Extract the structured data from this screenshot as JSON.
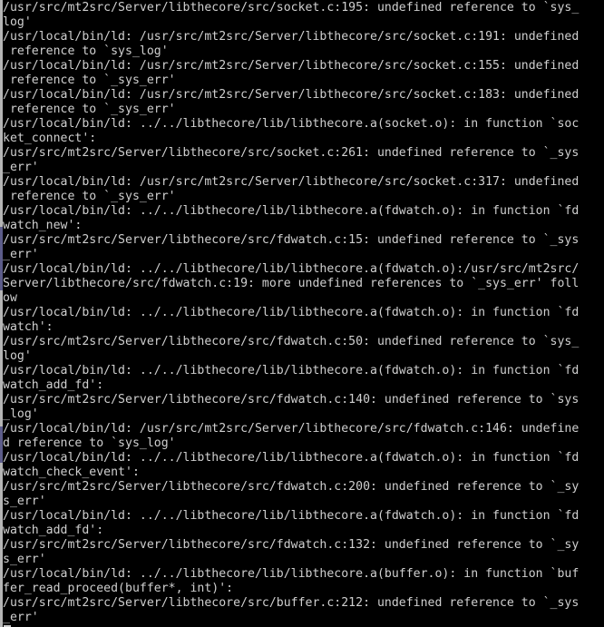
{
  "terminal": {
    "title": "Terminal",
    "columns": 80,
    "rows": 43,
    "background_color": "#000000",
    "foreground_color": "#cfcfcf",
    "scrollbar_color": "#b5b5b5",
    "scrollbar_thumb_color": "#5c5c8a",
    "cursor_glyph": "_",
    "lines": [
      "/usr/src/mt2src/Server/libthecore/src/socket.c:195: undefined reference to `sys_",
      "log'",
      "/usr/local/bin/ld: /usr/src/mt2src/Server/libthecore/src/socket.c:191: undefined",
      " reference to `sys_log'",
      "/usr/local/bin/ld: /usr/src/mt2src/Server/libthecore/src/socket.c:155: undefined",
      " reference to `_sys_err'",
      "/usr/local/bin/ld: /usr/src/mt2src/Server/libthecore/src/socket.c:183: undefined",
      " reference to `_sys_err'",
      "/usr/local/bin/ld: ../../libthecore/lib/libthecore.a(socket.o): in function `soc",
      "ket_connect':",
      "/usr/src/mt2src/Server/libthecore/src/socket.c:261: undefined reference to `_sys",
      "_err'",
      "/usr/local/bin/ld: /usr/src/mt2src/Server/libthecore/src/socket.c:317: undefined",
      " reference to `_sys_err'",
      "/usr/local/bin/ld: ../../libthecore/lib/libthecore.a(fdwatch.o): in function `fd",
      "watch_new':",
      "/usr/src/mt2src/Server/libthecore/src/fdwatch.c:15: undefined reference to `_sys",
      "_err'",
      "/usr/local/bin/ld: ../../libthecore/lib/libthecore.a(fdwatch.o):/usr/src/mt2src/",
      "Server/libthecore/src/fdwatch.c:19: more undefined references to `_sys_err' foll",
      "ow",
      "/usr/local/bin/ld: ../../libthecore/lib/libthecore.a(fdwatch.o): in function `fd",
      "watch':",
      "/usr/src/mt2src/Server/libthecore/src/fdwatch.c:50: undefined reference to `sys_",
      "log'",
      "/usr/local/bin/ld: ../../libthecore/lib/libthecore.a(fdwatch.o): in function `fd",
      "watch_add_fd':",
      "/usr/src/mt2src/Server/libthecore/src/fdwatch.c:140: undefined reference to `sys",
      "_log'",
      "/usr/local/bin/ld: /usr/src/mt2src/Server/libthecore/src/fdwatch.c:146: undefine",
      "d reference to `sys_log'",
      "/usr/local/bin/ld: ../../libthecore/lib/libthecore.a(fdwatch.o): in function `fd",
      "watch_check_event':",
      "/usr/src/mt2src/Server/libthecore/src/fdwatch.c:200: undefined reference to `_sy",
      "s_err'",
      "/usr/local/bin/ld: ../../libthecore/lib/libthecore.a(fdwatch.o): in function `fd",
      "watch_add_fd':",
      "/usr/src/mt2src/Server/libthecore/src/fdwatch.c:132: undefined reference to `_sy",
      "s_err'",
      "/usr/local/bin/ld: ../../libthecore/lib/libthecore.a(buffer.o): in function `buf",
      "fer_read_proceed(buffer*, int)':",
      "/usr/src/mt2src/Server/libthecore/src/buffer.c:212: undefined reference to `_sys",
      "_err'"
    ]
  }
}
